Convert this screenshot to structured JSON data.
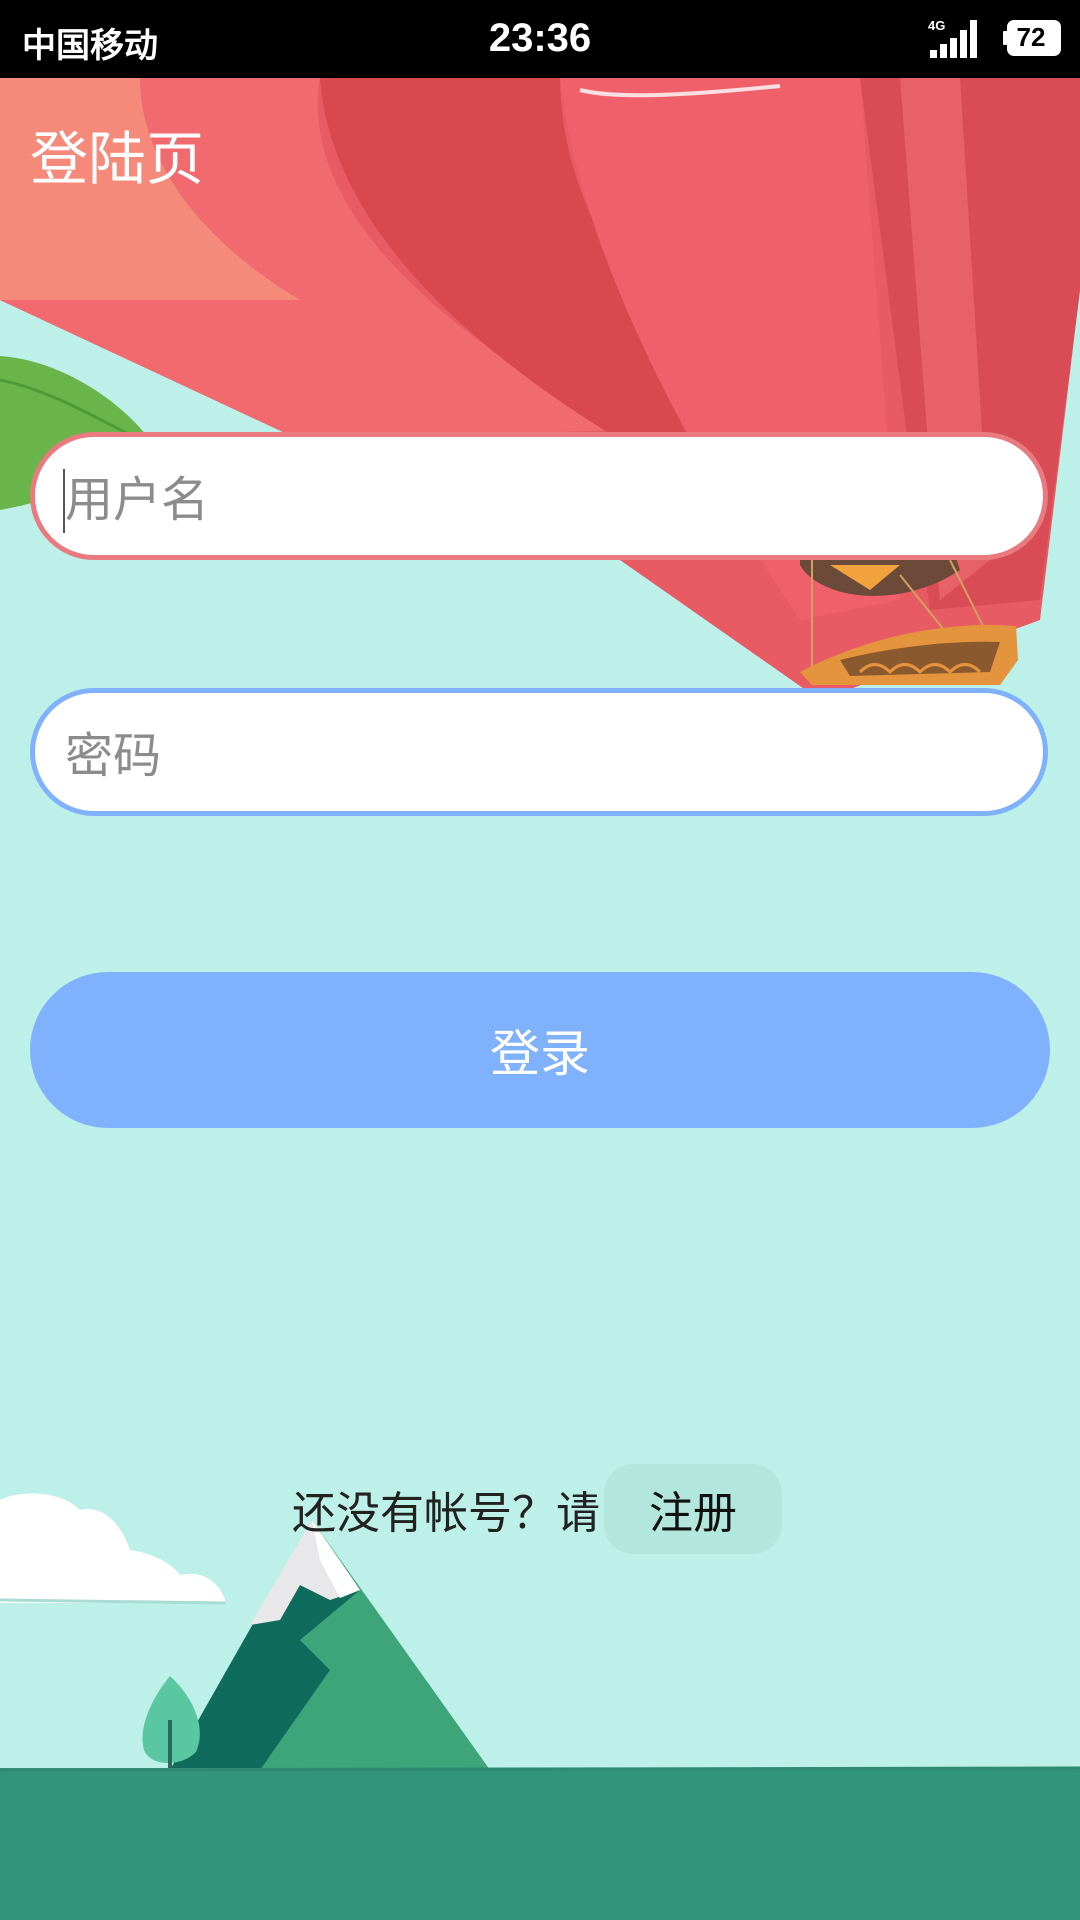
{
  "status_bar": {
    "carrier": "中国移动",
    "time": "23:36",
    "network": "4G",
    "battery": "72"
  },
  "page": {
    "title": "登陆页"
  },
  "form": {
    "username_placeholder": "用户名",
    "password_placeholder": "密码",
    "login_label": "登录"
  },
  "register": {
    "prompt": "还没有帐号？请",
    "button_label": "注册"
  },
  "colors": {
    "background": "#bcf0e8",
    "username_border": "#e97a80",
    "password_border": "#80b1fc",
    "login_button": "#80b1fc",
    "register_button": "#b3e6dc",
    "ground": "#33947c"
  },
  "icons": [
    "signal-icon",
    "battery-icon",
    "hot-air-balloon-illustration",
    "mountain-illustration",
    "cloud-illustration",
    "leaf-illustration",
    "tree-illustration"
  ]
}
